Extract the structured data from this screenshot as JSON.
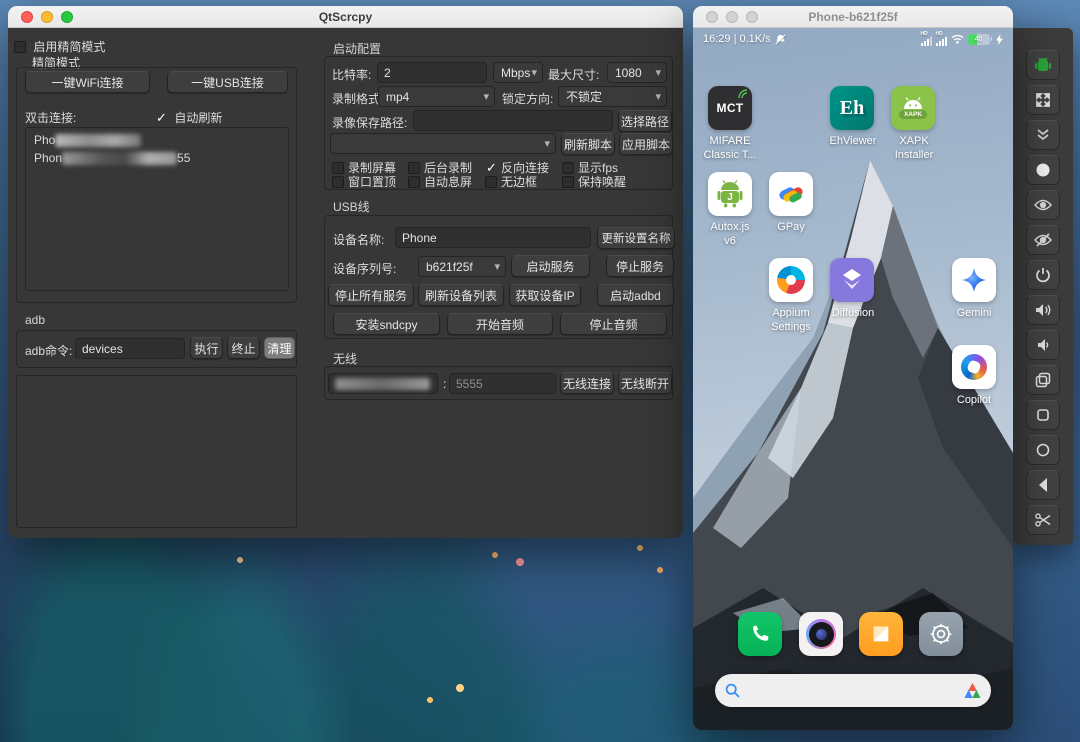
{
  "qtscrcpy": {
    "title": "QtScrcpy",
    "simple_mode": {
      "enable_label": "启用精简模式",
      "enable_checked": false,
      "mode_label": "精简模式"
    },
    "connect": {
      "wifi_button": "一键WiFi连接",
      "usb_button": "一键USB连接",
      "double_click_label": "双击连接:",
      "auto_refresh": {
        "label": "自动刷新",
        "checked": true
      },
      "devices": [
        {
          "visible_prefix": "Pho",
          "visible_suffix": "",
          "masked": true
        },
        {
          "visible_prefix": "Phon",
          "visible_suffix": "55",
          "masked": true
        }
      ]
    },
    "adb": {
      "section": "adb",
      "cmd_label": "adb命令:",
      "cmd_value": "devices",
      "run_button": "执行",
      "stop_button": "终止",
      "clear_button": "清理",
      "output": ""
    },
    "config": {
      "section": "启动配置",
      "bitrate_label": "比特率:",
      "bitrate_value": "2",
      "bitrate_unit": "Mbps",
      "max_size_label": "最大尺寸:",
      "max_size_value": "1080",
      "format_label": "录制格式:",
      "format_value": "mp4",
      "lock_label": "锁定方向:",
      "lock_value": "不锁定",
      "record_path_label": "录像保存路径:",
      "record_path_value": "",
      "choose_path_button": "选择路径",
      "script_combo_value": "",
      "refresh_script_button": "刷新脚本",
      "apply_script_button": "应用脚本",
      "checkboxes": [
        {
          "label": "录制屏幕",
          "checked": false
        },
        {
          "label": "窗口置顶",
          "checked": false
        },
        {
          "label": "后台录制",
          "checked": false
        },
        {
          "label": "自动息屏",
          "checked": false
        },
        {
          "label": "反向连接",
          "checked": true
        },
        {
          "label": "无边框",
          "checked": false
        },
        {
          "label": "显示fps",
          "checked": false
        },
        {
          "label": "保持唤醒",
          "checked": false
        }
      ]
    },
    "usb": {
      "section": "USB线",
      "device_name_label": "设备名称:",
      "device_name_value": "Phone",
      "update_name_button": "更新设置名称",
      "serial_label": "设备序列号:",
      "serial_value": "b621f25f",
      "start_service_button": "启动服务",
      "stop_service_button": "停止服务",
      "stop_all_button": "停止所有服务",
      "refresh_devices_button": "刷新设备列表",
      "get_ip_button": "获取设备IP",
      "start_adbd_button": "启动adbd",
      "install_sndcpy_button": "安装sndcpy",
      "start_audio_button": "开始音频",
      "stop_audio_button": "停止音频"
    },
    "wireless": {
      "section": "无线",
      "ip_masked": true,
      "separator": ":",
      "port_value": "5555",
      "connect_button": "无线连接",
      "disconnect_button": "无线断开"
    }
  },
  "phone": {
    "title": "Phone-b621f25f",
    "status_left": "16:29 | 0.1K/s",
    "battery_percent": "40",
    "apps": [
      {
        "name": "mifare-classic-tool",
        "icon_text": "MCT",
        "label": "MIFARE\nClassic T..."
      },
      {
        "name": "ehviewer",
        "icon_text": "Eh",
        "label": "EhViewer"
      },
      {
        "name": "xapk-installer",
        "icon_text": "XAPK",
        "label": "XAPK\nInstaller"
      },
      {
        "name": "autoxjs-v6",
        "icon_text": "J",
        "label": "Autox.js\nv6"
      },
      {
        "name": "gpay",
        "icon_text": "",
        "label": "GPay"
      },
      {
        "name": "appium-settings",
        "icon_text": "",
        "label": "Appium\nSettings"
      },
      {
        "name": "diffusion",
        "icon_text": "",
        "label": "Diffusion"
      },
      {
        "name": "gemini",
        "icon_text": "",
        "label": "Gemini"
      },
      {
        "name": "copilot",
        "icon_text": "",
        "label": "Copilot"
      }
    ],
    "dock": [
      "phone",
      "camera",
      "gallery",
      "settings"
    ],
    "toolbar_icons": [
      "android-group",
      "fullscreen",
      "collapse-chevrons",
      "record-dot",
      "eye-open",
      "eye-closed",
      "power",
      "volume-up",
      "volume-down",
      "app-switcher",
      "menu-square",
      "home-circle",
      "back-chevron",
      "screenshot-scissors"
    ]
  }
}
